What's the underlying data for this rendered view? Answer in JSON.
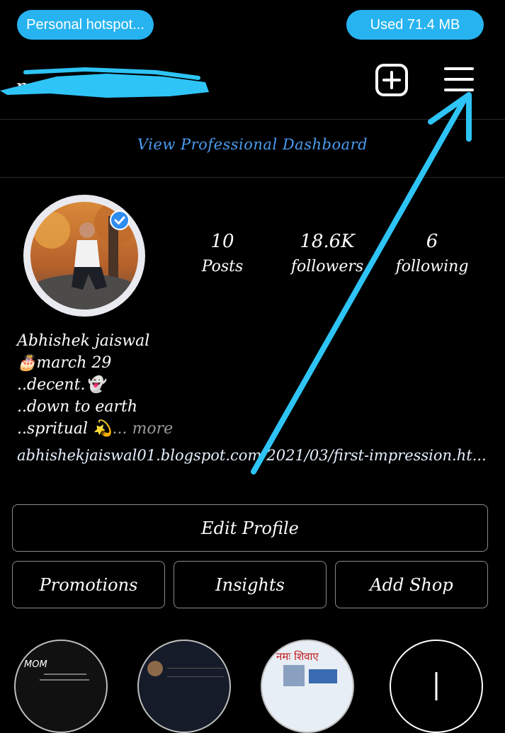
{
  "status_bar": {
    "hotspot_label": "Personal hotspot...",
    "data_used_label": "Used  71.4 MB"
  },
  "header": {
    "create_icon": "plus-square-icon",
    "menu_icon": "hamburger-menu-icon"
  },
  "dashboard": {
    "label": "View Professional Dashboard"
  },
  "profile": {
    "stats": [
      {
        "value": "10",
        "label": "Posts"
      },
      {
        "value": "18.6K",
        "label": "followers"
      },
      {
        "value": "6",
        "label": "following"
      }
    ],
    "bio": {
      "name": "Abhishek jaiswal",
      "line2": "march 29",
      "line3": "..decent.",
      "line4": "..down to earth",
      "line5": "..spritual",
      "more_label": "... more"
    },
    "link": "abhishekjaiswal01.blogspot.com/2021/03/first-impression.ht..."
  },
  "actions": {
    "edit_profile": "Edit Profile",
    "promotions": "Promotions",
    "insights": "Insights",
    "add_shop": "Add Shop"
  },
  "highlights": {
    "h1_text": "MOM",
    "h3_text": "नमः शिवाए"
  },
  "colors": {
    "accent": "#27b3f0",
    "dashboard_link": "#4a9cf0",
    "annotation_arrow": "#2ec4f6"
  }
}
